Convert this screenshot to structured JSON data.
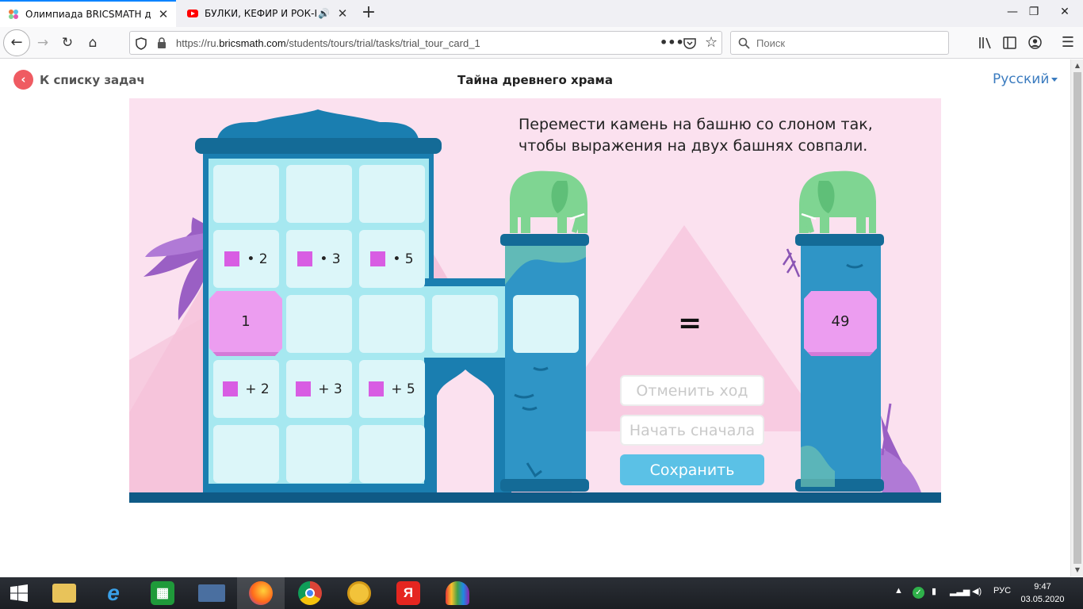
{
  "browser": {
    "tabs": [
      {
        "title": "Олимпиада BRICSMATH для у",
        "active": true,
        "favicon": "bricsmath-icon"
      },
      {
        "title": "БУЛКИ, КЕФИР И РОК-Н-Р",
        "active": false,
        "favicon": "youtube-icon",
        "audio": true
      }
    ],
    "url_prefix": "https://ru.",
    "url_domain": "bricsmath.com",
    "url_path": "/students/tours/trial/tasks/trial_tour_card_1",
    "search_placeholder": "Поиск"
  },
  "page": {
    "back_label": "К списку задач",
    "title": "Тайна древнего храма",
    "language": "Русский",
    "task_text": "Перемести камень на башню со слоном так, чтобы выражения на двух башнях совпали.",
    "grid_labels": {
      "mul2": "• 2",
      "mul3": "• 3",
      "mul5": "• 5",
      "add2": "+ 2",
      "add3": "+ 3",
      "add5": "+ 5"
    },
    "stone_start": "1",
    "target_stone": "49",
    "equals": "=",
    "buttons": {
      "undo": "Отменить ход",
      "restart": "Начать сначала",
      "save": "Сохранить"
    }
  },
  "taskbar": {
    "language": "РУС",
    "time": "9:47",
    "date": "03.05.2020",
    "yandex_letter": "Я"
  },
  "colors": {
    "scene_bg": "#fbe1ef",
    "temple_blue": "#1a7eb0",
    "cell": "#dcf6f9",
    "stone": "#ec9df0",
    "elephant": "#7fd592",
    "save_button": "#5bc1e6",
    "back_dot": "#ef5b62"
  }
}
